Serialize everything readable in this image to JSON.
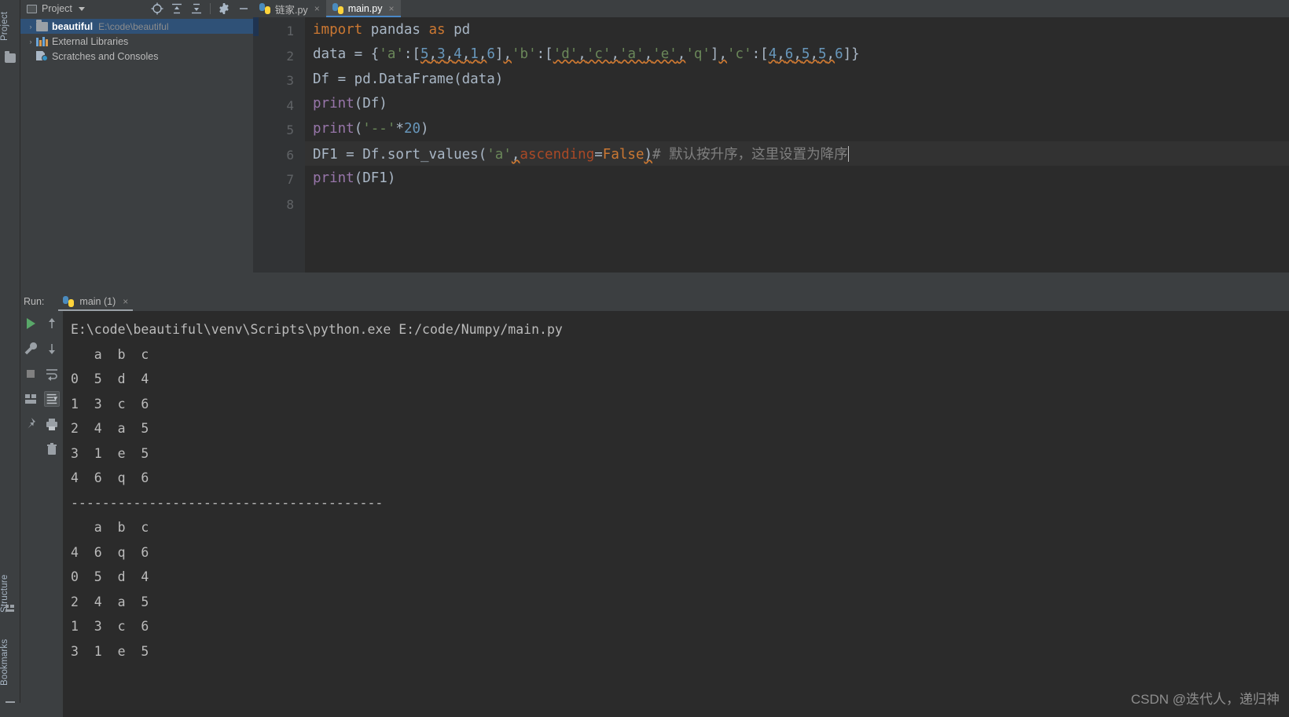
{
  "app": {
    "theme_bg": "#3c3f41",
    "editor_bg": "#2b2b2b",
    "accent": "#4a88c7",
    "selection": "#2f5177"
  },
  "left_rail": {
    "project_label": "Project",
    "structure_label": "Structure",
    "bookmarks_label": "Bookmarks"
  },
  "project_panel": {
    "title": "Project",
    "tools": [
      {
        "name": "locate-icon",
        "glyph": "locate"
      },
      {
        "name": "expand-all-icon",
        "glyph": "expand"
      },
      {
        "name": "collapse-all-icon",
        "glyph": "collapse"
      },
      {
        "name": "settings-gear-icon",
        "glyph": "gear"
      },
      {
        "name": "hide-icon",
        "glyph": "minus"
      }
    ],
    "tree": [
      {
        "name": "beautiful",
        "path": "E:\\code\\beautiful",
        "icon": "folder-icon",
        "selected": true,
        "arrow": "›"
      },
      {
        "name": "External Libraries",
        "path": "",
        "icon": "library-icon",
        "selected": false,
        "arrow": "›"
      },
      {
        "name": "Scratches and Consoles",
        "path": "",
        "icon": "scratches-icon",
        "selected": false,
        "arrow": ""
      }
    ]
  },
  "tabs": [
    {
      "label": "链家.py",
      "active": false,
      "close": "×"
    },
    {
      "label": "main.py",
      "active": true,
      "close": "×"
    }
  ],
  "editor": {
    "line_numbers": [
      "1",
      "2",
      "3",
      "4",
      "5",
      "6",
      "7",
      "8"
    ],
    "current_line": 6,
    "lines": [
      {
        "n": 1,
        "text": "import pandas as pd"
      },
      {
        "n": 2,
        "text": "data = {'a':[5,3,4,1,6],'b':['d','c','a','e','q'],'c':[4,6,5,5,6]}"
      },
      {
        "n": 3,
        "text": "Df = pd.DataFrame(data)"
      },
      {
        "n": 4,
        "text": "print(Df)"
      },
      {
        "n": 5,
        "text": "print('--'*20)"
      },
      {
        "n": 6,
        "text": "DF1 = Df.sort_values('a',ascending=False) # 默认按升序，这里设置为降序"
      },
      {
        "n": 7,
        "text": "print(DF1)"
      },
      {
        "n": 8,
        "text": ""
      }
    ],
    "tokens": {
      "l1_import": "import",
      "l1_mod": " pandas ",
      "l1_as": "as",
      "l1_alias": " pd",
      "l2_data": "data = {",
      "l2_sa": "'a'",
      "l2_c1": ":[",
      "l2_n5": "5",
      "l2_n3": "3",
      "l2_n4": "4",
      "l2_n1": "1",
      "l2_n6": "6",
      "l2_sb": "'b'",
      "l2_d": "'d'",
      "l2_c": "'c'",
      "l2_a": "'a'",
      "l2_e": "'e'",
      "l2_q": "'q'",
      "l2_sc": "'c'",
      "l2_n4b": "4",
      "l2_n6b": "6",
      "l2_n5b": "5",
      "l2_n5c": "5",
      "l2_n6c": "6",
      "l3": "Df = pd.DataFrame(data)",
      "l4a": "print",
      "l4b": "(Df)",
      "l5a": "print",
      "l5b": "(",
      "l5str": "'--'",
      "l5c": "*",
      "l5n": "20",
      "l5d": ")",
      "l6a": "DF1 = Df.sort_values(",
      "l6str": "'a'",
      "l6comma": ",",
      "l6kw": "ascending",
      "l6eq": "=",
      "l6false": "False",
      "l6close": ")",
      "l6comment": "# 默认按升序，这里设置为降序",
      "l7a": "print",
      "l7b": "(DF1)"
    }
  },
  "run_panel": {
    "label": "Run:",
    "tab_label": "main (1)",
    "tab_close": "×",
    "toolbar_left": [
      {
        "name": "rerun-button",
        "glyph": "play"
      },
      {
        "name": "edit-configurations-button",
        "glyph": "wrench"
      },
      {
        "name": "stop-button",
        "glyph": "stop"
      },
      {
        "name": "layout-button",
        "glyph": "layout"
      },
      {
        "name": "pin-tab-button",
        "glyph": "pin"
      }
    ],
    "toolbar_right": [
      {
        "name": "up-arrow-button",
        "glyph": "up"
      },
      {
        "name": "down-arrow-button",
        "glyph": "down"
      },
      {
        "name": "soft-wrap-button",
        "glyph": "wrap"
      },
      {
        "name": "scroll-to-end-button",
        "glyph": "scroll-end"
      },
      {
        "name": "print-button",
        "glyph": "print"
      },
      {
        "name": "clear-all-button",
        "glyph": "trash"
      }
    ],
    "console_lines": [
      "E:\\code\\beautiful\\venv\\Scripts\\python.exe E:/code/Numpy/main.py",
      "   a  b  c",
      "0  5  d  4",
      "1  3  c  6",
      "2  4  a  5",
      "3  1  e  5",
      "4  6  q  6",
      "----------------------------------------",
      "   a  b  c",
      "4  6  q  6",
      "0  5  d  4",
      "2  4  a  5",
      "1  3  c  6",
      "3  1  e  5"
    ]
  },
  "watermark": {
    "text": "CSDN @迭代人，递归神"
  }
}
